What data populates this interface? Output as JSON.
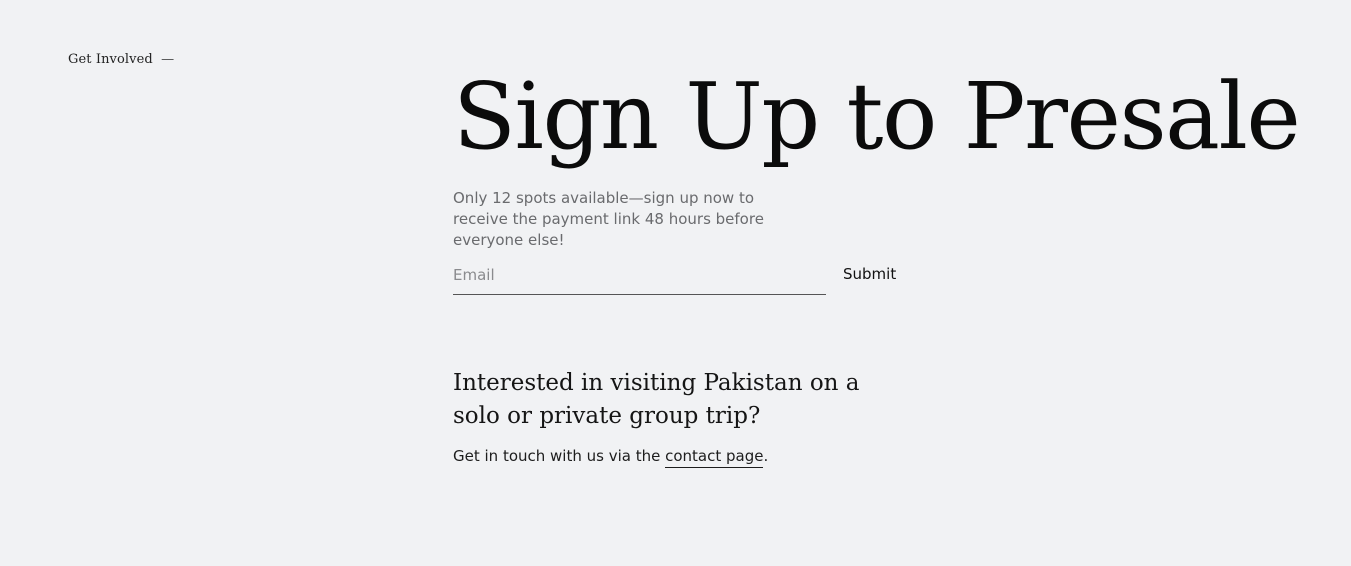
{
  "eyebrow": {
    "label": "Get Involved",
    "dash": "—"
  },
  "hero": {
    "title": "Sign Up to Presale"
  },
  "presale": {
    "description": "Only 12 spots available—sign up now to receive the payment link 48 hours before everyone else!",
    "email_placeholder": "Email",
    "submit_label": "Submit"
  },
  "trip": {
    "heading": "Interested in visiting Pakistan on a solo or private group trip?",
    "text_prefix": "Get in touch with us via the ",
    "link_label": "contact page",
    "text_suffix": "."
  },
  "colors": {
    "background": "#f1f2f4",
    "text": "#111111",
    "muted": "#6a6b6e"
  }
}
